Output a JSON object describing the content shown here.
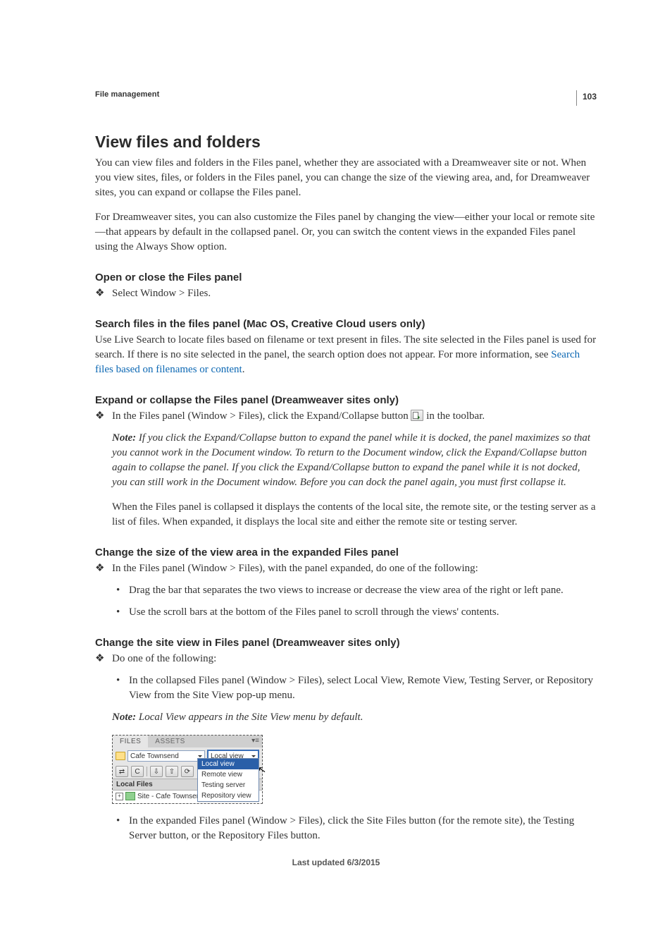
{
  "page_number": "103",
  "running_head": "File management",
  "h1": "View files and folders",
  "intro_p1": "You can view files and folders in the Files panel, whether they are associated with a Dreamweaver site or not. When you view sites, files, or folders in the Files panel, you can change the size of the viewing area, and, for Dreamweaver sites, you can expand or collapse the Files panel.",
  "intro_p2": "For Dreamweaver sites, you can also customize the Files panel by changing the view—either your local or remote site—that appears by default in the collapsed panel. Or, you can switch the content views in the expanded Files panel using the Always Show option.",
  "sec1_h": "Open or close the Files panel",
  "sec1_item": "Select Window > Files.",
  "sec2_h": "Search files in the files panel (Mac OS, Creative Cloud users only)",
  "sec2_p_a": "Use Live Search to locate files based on filename or text present in files. The site selected in the Files panel is used for search. If there is no site selected in the panel, the search option does not appear. For more information, see ",
  "sec2_link": "Search files based on filenames or content",
  "sec2_p_b": ".",
  "sec3_h": "Expand or collapse the Files panel (Dreamweaver sites only)",
  "sec3_item_a": "In the Files panel (Window > Files), click the Expand/Collapse button ",
  "sec3_item_b": " in the toolbar.",
  "note_label": "Note: ",
  "sec3_note": "If you click the Expand/Collapse button to expand the panel while it is docked, the panel maximizes so that you cannot work in the Document window. To return to the Document window, click the Expand/Collapse button again to collapse the panel. If you click the Expand/Collapse button to expand the panel while it is not docked, you can still work in the Document window. Before you can dock the panel again, you must first collapse it.",
  "sec3_p2": "When the Files panel is collapsed it displays the contents of the local site, the remote site, or the testing server as a list of files. When expanded, it displays the local site and either the remote site or testing server.",
  "sec4_h": "Change the size of the view area in the expanded Files panel",
  "sec4_item": "In the Files panel (Window > Files), with the panel expanded, do one of the following:",
  "sec4_sub1": "Drag the bar that separates the two views to increase or decrease the view area of the right or left pane.",
  "sec4_sub2": "Use the scroll bars at the bottom of the Files panel to scroll through the views' contents.",
  "sec5_h": "Change the site view in Files panel (Dreamweaver sites only)",
  "sec5_item": "Do one of the following:",
  "sec5_sub1": "In the collapsed Files panel (Window > Files), select Local View, Remote View, Testing Server, or Repository View from the Site View pop-up menu.",
  "sec5_note": "Local View appears in the Site View menu by default.",
  "sec5_sub2": "In the expanded Files panel (Window > Files), click the Site Files button (for the remote site), the Testing Server button, or the Repository Files button.",
  "footer": "Last updated 6/3/2015",
  "shot": {
    "tab_files": "FILES",
    "tab_assets": "ASSETS",
    "site_name": "Cafe Townsend",
    "view_selected": "Local view",
    "menu": [
      "Local view",
      "Remote view",
      "Testing server",
      "Repository view"
    ],
    "local_files_label": "Local Files",
    "tree_row": "Site - Cafe Townsen"
  }
}
